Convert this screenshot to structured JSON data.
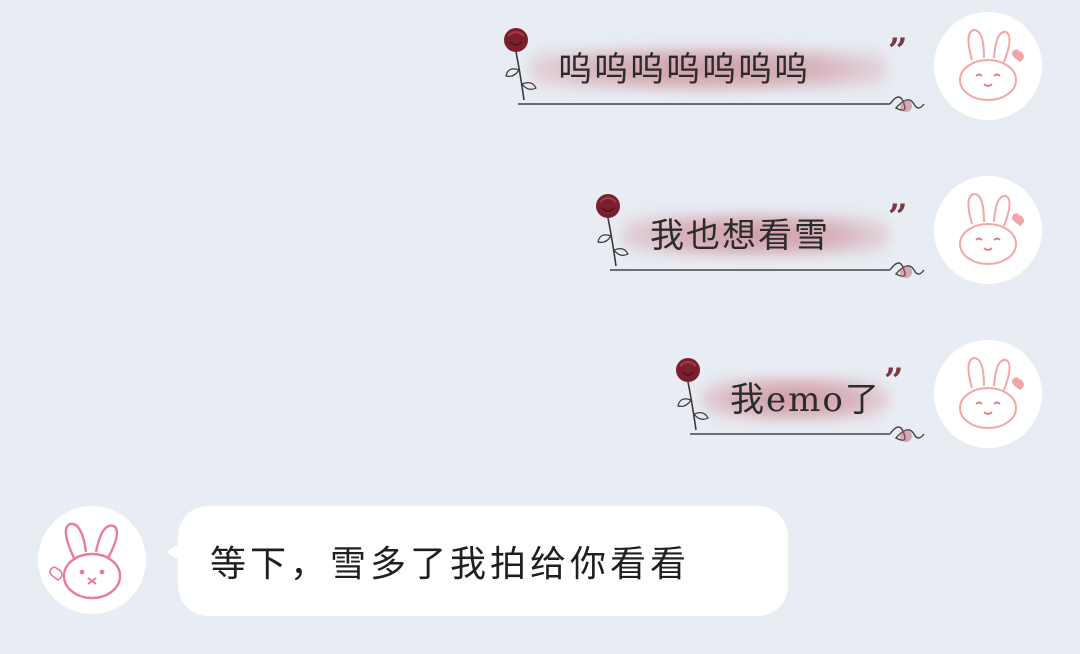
{
  "chat": {
    "messages": [
      {
        "side": "right",
        "text": "呜呜呜呜呜呜呜"
      },
      {
        "side": "right",
        "text": "我也想看雪"
      },
      {
        "side": "right",
        "text": "我emo了"
      },
      {
        "side": "left",
        "text": "等下，雪多了我拍给你看看"
      }
    ]
  },
  "icons": {
    "self_avatar": "bunny-icon",
    "other_avatar": "bunny-icon",
    "rose": "rose-icon",
    "quote": "quote-mark-icon"
  },
  "colors": {
    "background": "#e8ecf3",
    "bubble": "#ffffff",
    "blush": "#b85a68",
    "self_bunny": "#f2a7a7",
    "other_bunny": "#e87aa6",
    "rose": "#7a1f2c"
  }
}
